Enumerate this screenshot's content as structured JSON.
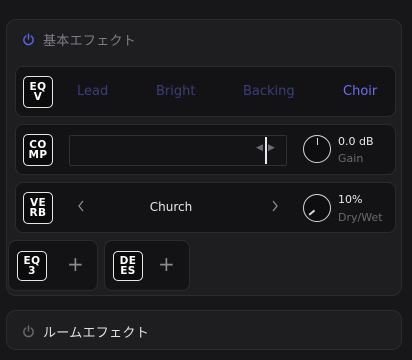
{
  "basic_effects": {
    "title": "基本エフェクト",
    "eq": {
      "badge_line1": "EQ",
      "badge_line2": "V",
      "presets": [
        "Lead",
        "Bright",
        "Backing",
        "Choir"
      ],
      "selected": "Choir"
    },
    "comp": {
      "badge_line1": "CO",
      "badge_line2": "MP",
      "knob_value": "0.0 dB",
      "knob_label": "Gain"
    },
    "verb": {
      "badge_line1": "VE",
      "badge_line2": "RB",
      "preset": "Church",
      "knob_value": "10%",
      "knob_label": "Dry/Wet"
    },
    "slots": [
      {
        "badge_line1": "EQ",
        "badge_line2": "3",
        "action": "+"
      },
      {
        "badge_line1": "DE",
        "badge_line2": "ES",
        "action": "+"
      }
    ]
  },
  "room_effects": {
    "title": "ルームエフェクト"
  },
  "colors": {
    "accent": "#6b70f0",
    "accent_dim": "#3a3e7a",
    "background": "#171719",
    "panel": "#1e1e21"
  },
  "icons": {
    "power": "power-icon",
    "prev": "chevron-left-icon",
    "next": "chevron-right-icon",
    "add": "plus-icon"
  }
}
